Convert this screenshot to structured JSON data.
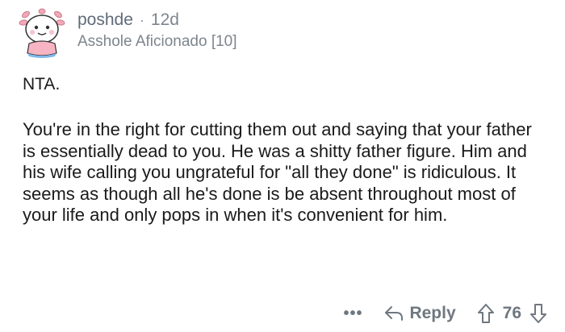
{
  "comment": {
    "author": "poshde",
    "separator": "·",
    "age": "12d",
    "flair": "Asshole Aficionado [10]",
    "verdict": "NTA.",
    "body": "You're in the right for cutting them out and saying that your father is essentially dead to you. He was a shitty father figure. Him and his wife calling you ungrateful for \"all they done\" is ridiculous. It seems as though all he's done is be absent throughout most of your life and only pops in when it's convenient for him."
  },
  "actions": {
    "more_label": "•••",
    "reply_label": "Reply",
    "score": "76"
  },
  "icons": {
    "avatar": "avatar-snoo-icon",
    "reply": "reply-arrow-icon",
    "upvote": "upvote-arrow-icon",
    "downvote": "downvote-arrow-icon"
  },
  "colors": {
    "text": "#1a1a1b",
    "meta": "#7d858e",
    "avatar_accent": "#f3a8b8"
  }
}
